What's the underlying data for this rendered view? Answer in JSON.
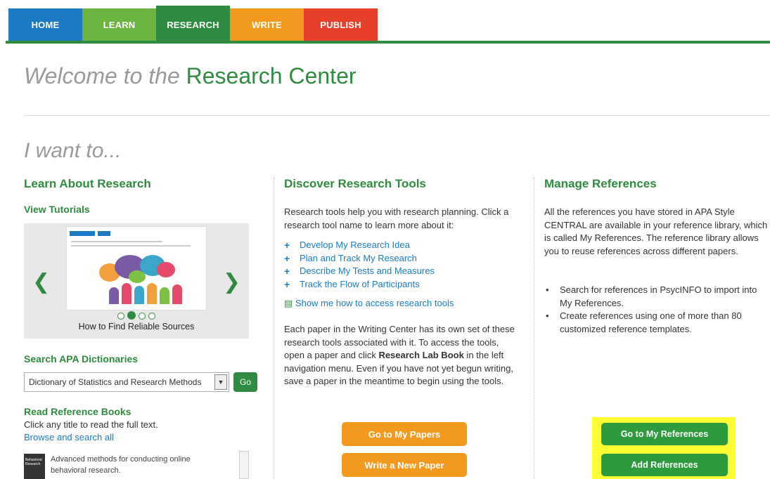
{
  "nav": {
    "tabs": [
      "HOME",
      "LEARN",
      "RESEARCH",
      "WRITE",
      "PUBLISH"
    ],
    "active": "RESEARCH",
    "colors": {
      "home": "#1a7bc4",
      "learn": "#6cb33f",
      "research": "#2e8b3f",
      "write": "#f39a1e",
      "publish": "#e8412b"
    }
  },
  "welcome": {
    "prefix": "Welcome to the",
    "title": "Research Center"
  },
  "want": "I want to...",
  "learn": {
    "title": "Learn About Research",
    "tutorials_label": "View Tutorials",
    "carousel": {
      "caption": "How to Find Reliable Sources",
      "slides": 4,
      "active_slide": 2,
      "prev_icon": "chevron-left-icon",
      "next_icon": "chevron-right-icon"
    },
    "dictionaries_label": "Search APA Dictionaries",
    "dictionary_selected": "Dictionary of Statistics and Research Methods",
    "go_label": "Go",
    "books_label": "Read Reference Books",
    "books_intro": "Click any title to read the full text.",
    "browse_link": "Browse and search all",
    "book_desc": "Advanced methods for conducting online behavioral research."
  },
  "tools": {
    "title": "Discover Research Tools",
    "intro": "Research tools help you with research planning. Click a research tool name to learn more about it:",
    "items": [
      "Develop My Research Idea",
      "Plan and Track My Research",
      "Describe My Tests and Measures",
      "Track the Flow of Participants"
    ],
    "show_me": "Show me how to access research tools",
    "body_1": "Each paper in the Writing Center has its own set of these research tools associated with it. To access the tools, open a paper and click ",
    "body_bold": "Research Lab Book",
    "body_2": " in the left navigation menu. Even if you have not yet begun writing, save a paper in the meantime to begin using the tools.",
    "btn_papers": "Go to My Papers",
    "btn_new": "Write a New Paper"
  },
  "references": {
    "title": "Manage References",
    "intro": "All the references you have stored in APA Style CENTRAL are available in your reference library, which is called My References. The reference library allows you to reuse references across different papers.",
    "bullets": [
      "Search for references in PsycINFO to import into My References.",
      "Create references using one of more than 80 customized reference templates."
    ],
    "btn_go": "Go to My References",
    "btn_add": "Add References"
  }
}
